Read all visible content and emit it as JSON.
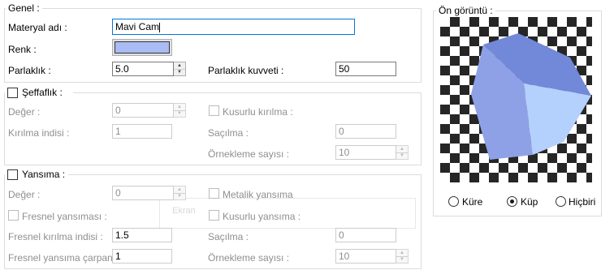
{
  "general": {
    "title": "Genel :",
    "material_name_label": "Materyal adı :",
    "material_name_value": "Mavi Cam",
    "color_label": "Renk :",
    "color_value": "#aabcf4",
    "gloss_label": "Parlaklık :",
    "gloss_value": "5.0",
    "gloss_strength_label": "Parlaklık kuvveti :",
    "gloss_strength_value": "50"
  },
  "transparency": {
    "title": "Şeffaflık :",
    "value_label": "Değer :",
    "value_value": "0",
    "refraction_index_label": "Kırılma indisi :",
    "refraction_index_value": "1",
    "blurred_refraction_label": "Kusurlu kırılma :",
    "scatter_label": "Saçılma :",
    "scatter_value": "0",
    "samples_label": "Örnekleme sayısı :",
    "samples_value": "10"
  },
  "reflection": {
    "title": "Yansıma :",
    "value_label": "Değer :",
    "value_value": "0",
    "metallic_label": "Metalik yansıma",
    "fresnel_label": "Fresnel yansıması :",
    "blurred_reflection_label": "Kusurlu yansıma :",
    "fresnel_ior_label": "Fresnel kırılma indisi :",
    "fresnel_ior_value": "1.5",
    "fresnel_factor_label": "Fresnel yansıma çarpanı :",
    "fresnel_factor_value": "1",
    "scatter_label": "Saçılma :",
    "scatter_value": "0",
    "samples_label": "Örnekleme sayısı :",
    "samples_value": "10"
  },
  "preview": {
    "title": "Ön görüntü :",
    "options": [
      "Küre",
      "Küp",
      "Hiçbiri"
    ],
    "selected": "Küp",
    "cube_colors": {
      "left": "#8ea1e6",
      "top": "#7288d8",
      "right": "#b4d0fd"
    }
  },
  "ghost": {
    "text": "Ekran"
  }
}
